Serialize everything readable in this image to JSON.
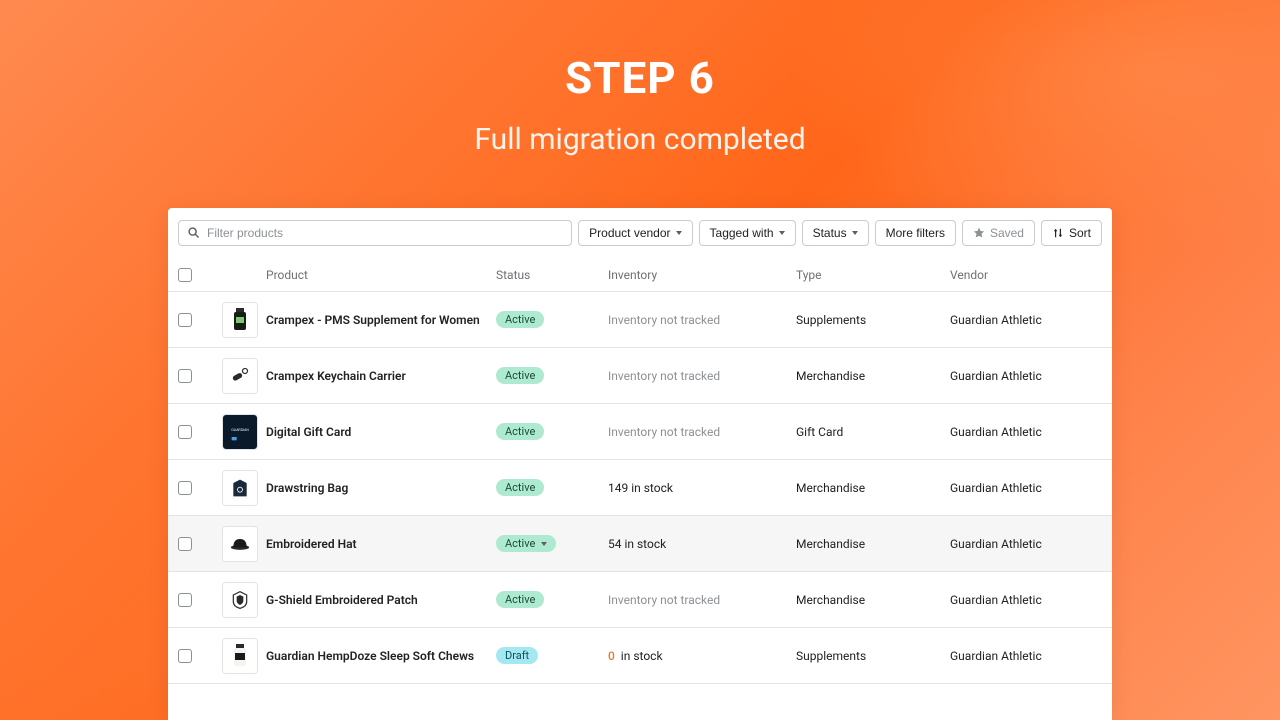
{
  "header": {
    "step_label": "STEP 6",
    "subtitle": "Full migration completed"
  },
  "filters": {
    "search_placeholder": "Filter products",
    "vendor_btn": "Product vendor",
    "tagged_btn": "Tagged with",
    "status_btn": "Status",
    "more_btn": "More filters",
    "saved_btn": "Saved",
    "sort_btn": "Sort"
  },
  "columns": {
    "product": "Product",
    "status": "Status",
    "inventory": "Inventory",
    "type": "Type",
    "vendor": "Vendor"
  },
  "rows": [
    {
      "name": "Crampex - PMS Supplement for Women",
      "status": "Active",
      "status_kind": "active",
      "inventory": "Inventory not tracked",
      "inventory_kind": "muted",
      "type": "Supplements",
      "vendor": "Guardian Athletic",
      "thumb": "bottle1"
    },
    {
      "name": "Crampex Keychain Carrier",
      "status": "Active",
      "status_kind": "active",
      "inventory": "Inventory not tracked",
      "inventory_kind": "muted",
      "type": "Merchandise",
      "vendor": "Guardian Athletic",
      "thumb": "keychain"
    },
    {
      "name": "Digital Gift Card",
      "status": "Active",
      "status_kind": "active",
      "inventory": "Inventory not tracked",
      "inventory_kind": "muted",
      "type": "Gift Card",
      "vendor": "Guardian Athletic",
      "thumb": "giftcard"
    },
    {
      "name": "Drawstring Bag",
      "status": "Active",
      "status_kind": "active",
      "inventory": "149 in stock",
      "inventory_kind": "normal",
      "type": "Merchandise",
      "vendor": "Guardian Athletic",
      "thumb": "bag"
    },
    {
      "name": "Embroidered Hat",
      "status": "Active",
      "status_kind": "active",
      "status_caret": true,
      "inventory": "54 in stock",
      "inventory_kind": "normal",
      "type": "Merchandise",
      "vendor": "Guardian Athletic",
      "thumb": "hat",
      "selected": true
    },
    {
      "name": "G-Shield Embroidered Patch",
      "status": "Active",
      "status_kind": "active",
      "inventory": "Inventory not tracked",
      "inventory_kind": "muted",
      "type": "Merchandise",
      "vendor": "Guardian Athletic",
      "thumb": "patch"
    },
    {
      "name": "Guardian HempDoze Sleep Soft Chews",
      "status": "Draft",
      "status_kind": "draft",
      "inventory_qty": "0",
      "inventory_suffix": "in stock",
      "inventory_kind": "warn",
      "type": "Supplements",
      "vendor": "Guardian Athletic",
      "thumb": "bottle2"
    }
  ]
}
